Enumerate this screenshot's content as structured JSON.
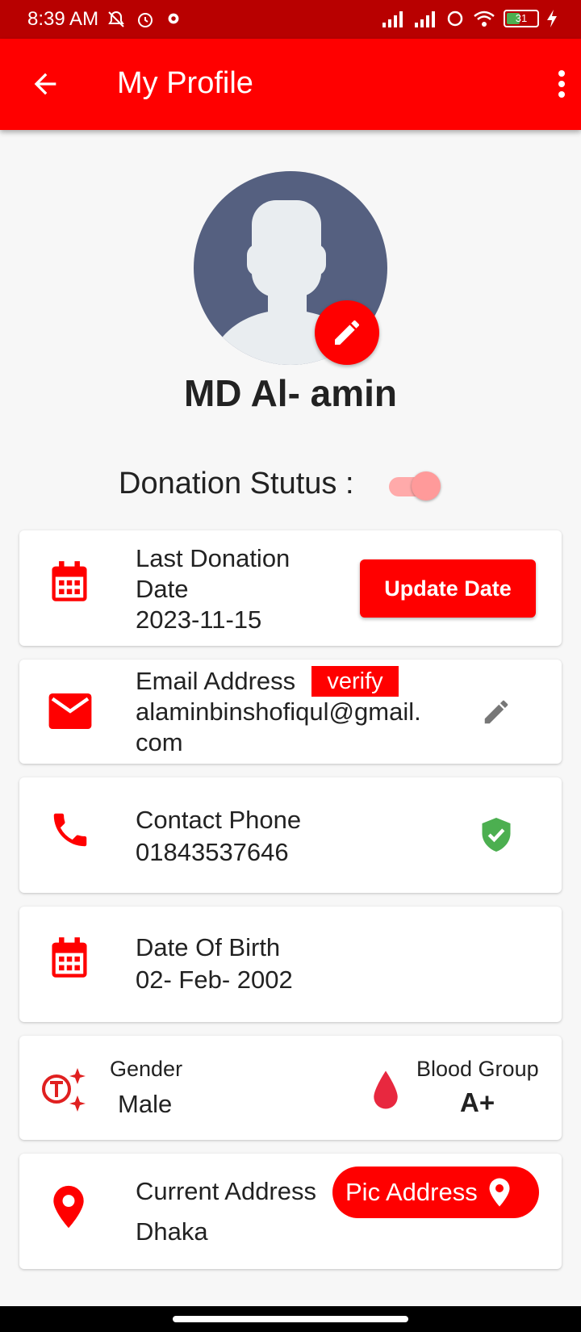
{
  "status_bar": {
    "time": "8:39 AM",
    "battery": "31"
  },
  "app_bar": {
    "title": "My Profile"
  },
  "profile": {
    "name": "MD Al- amin"
  },
  "donation_status": {
    "label": "Donation Stutus :",
    "enabled": true
  },
  "last_donation": {
    "label": "Last Donation Date",
    "date": "2023-11-15",
    "button": "Update Date"
  },
  "email": {
    "label": "Email Address",
    "verify_label": "verify",
    "value": "alaminbinshofiqul@gmail.com"
  },
  "phone": {
    "label": "Contact Phone",
    "value": "01843537646"
  },
  "dob": {
    "label": "Date Of Birth",
    "value": "02- Feb- 2002"
  },
  "gender": {
    "label": "Gender",
    "value": "Male"
  },
  "blood_group": {
    "label": "Blood Group",
    "value": "A+"
  },
  "address": {
    "label": "Current Address",
    "value": "Dhaka",
    "button": "Pic Address"
  },
  "colors": {
    "primary": "#ff0000",
    "status_bar": "#b80000",
    "verified": "#4caf50",
    "avatar_bg": "#556080"
  }
}
